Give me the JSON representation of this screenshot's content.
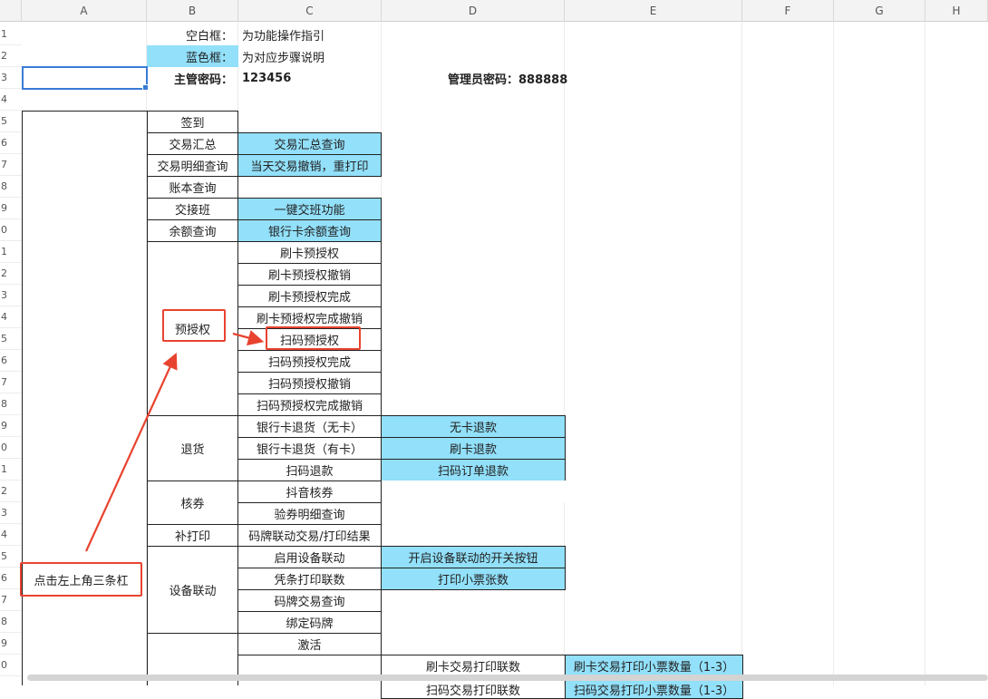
{
  "columns": [
    "A",
    "B",
    "C",
    "D",
    "E",
    "F",
    "G",
    "H"
  ],
  "rows": [
    "1",
    "2",
    "3",
    "4",
    "5",
    "6",
    "7",
    "8",
    "9",
    "0",
    "1",
    "2",
    "3",
    "4",
    "5",
    "6",
    "7",
    "8",
    "9",
    "0",
    "1",
    "2",
    "3",
    "4",
    "5",
    "6",
    "7",
    "8",
    "9",
    "0"
  ],
  "legend": {
    "blank_label": "空白框：",
    "blank_desc": "为功能操作指引",
    "blue_label": "蓝色框：",
    "blue_desc": "为对应步骤说明"
  },
  "passwords": {
    "supervisor": "主管密码：",
    "supervisor_value": "123456",
    "admin": "管理员密码：888888"
  },
  "menu": {
    "sign_in": "签到",
    "summary": "交易汇总",
    "summary_desc": "交易汇总查询",
    "detail": "交易明细查询",
    "detail_desc": "当天交易撤销，重打印",
    "ledger": "账本查询",
    "shift": "交接班",
    "shift_desc": "一键交班功能",
    "balance": "余额查询",
    "balance_desc": "银行卡余额查询",
    "preauth": "预授权",
    "preauth_items": [
      "刷卡预授权",
      "刷卡预授权撤销",
      "刷卡预授权完成",
      "刷卡预授权完成撤销",
      "扫码预授权",
      "扫码预授权完成",
      "扫码预授权撤销",
      "扫码预授权完成撤销"
    ],
    "refund": "退货",
    "refund_items": [
      "银行卡退货（无卡）",
      "银行卡退货（有卡）",
      "扫码退款"
    ],
    "refund_desc": [
      "无卡退款",
      "刷卡退款",
      "扫码订单退款"
    ],
    "coupon": "核券",
    "coupon_items": [
      "抖音核券",
      "验券明细查询"
    ],
    "reprint": "补打印",
    "reprint_desc": "码牌联动交易/打印结果",
    "linkage": "设备联动",
    "linkage_items": [
      "启用设备联动",
      "凭条打印联数",
      "码牌交易查询",
      "绑定码牌"
    ],
    "linkage_desc": [
      "开启设备联动的开关按钮",
      "打印小票张数"
    ],
    "activate": "激活",
    "card_print": "刷卡交易打印联数",
    "card_print_desc": "刷卡交易打印小票数量（1-3）",
    "scan_print": "扫码交易打印联数",
    "scan_print_desc": "扫码交易打印小票数量（1-3）"
  },
  "annotation": {
    "callout": "点击左上角三条杠"
  },
  "colors": {
    "blue_fill": "#92e0fa",
    "red_annotation": "#e8432f",
    "selection": "#3a7bd5"
  }
}
